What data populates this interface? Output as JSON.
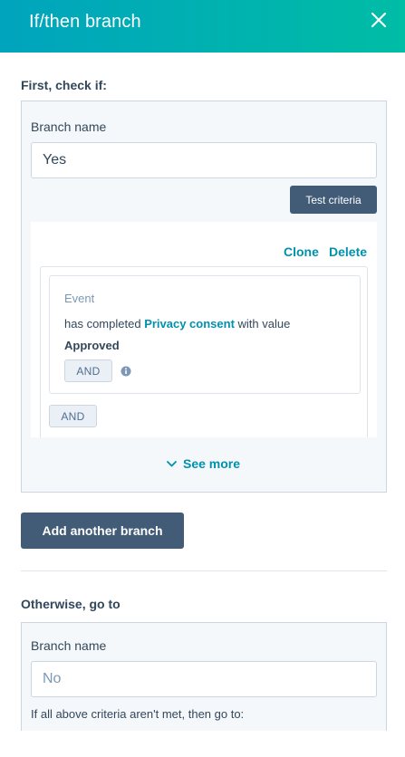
{
  "header": {
    "title": "If/then branch",
    "close_icon": "close-icon"
  },
  "first_section": {
    "label": "First, check if:",
    "branch": {
      "name_label": "Branch name",
      "name_value": "Yes",
      "test_criteria_label": "Test criteria",
      "actions": {
        "clone": "Clone",
        "delete": "Delete"
      },
      "filter": {
        "type": "Event",
        "text_prefix": "has completed",
        "property": "Privacy consent",
        "text_suffix": "with value",
        "value": "Approved",
        "and_label": "AND"
      },
      "group_and_label": "AND",
      "see_more_label": "See more"
    }
  },
  "add_branch_label": "Add another branch",
  "otherwise_section": {
    "label": "Otherwise, go to",
    "name_label": "Branch name",
    "name_placeholder": "No",
    "help_text": "If all above criteria aren't met, then go to:"
  },
  "colors": {
    "header_start": "#00a4bd",
    "header_end": "#00bda5",
    "link": "#0091ae",
    "button_dark": "#425b76"
  }
}
